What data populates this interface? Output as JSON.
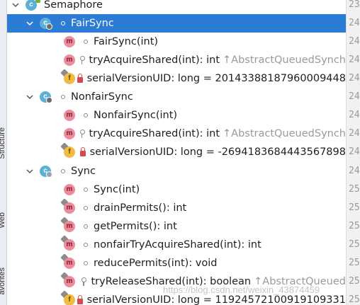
{
  "tool_window_tabs": [
    "Structure",
    "Web",
    "avorites"
  ],
  "tree": {
    "items": [
      {
        "label": "Semaphore",
        "kind": "class"
      },
      {
        "label": "FairSync",
        "kind": "class"
      },
      {
        "label": "FairSync(int)",
        "kind": "method"
      },
      {
        "label": "tryAcquireShared(int): int",
        "suffix": "AbstractQueuedSynch",
        "kind": "method"
      },
      {
        "label": "serialVersionUID: long = 20143388187960009448",
        "kind": "field"
      },
      {
        "label": "NonfairSync",
        "kind": "class"
      },
      {
        "label": "NonfairSync(int)",
        "kind": "method"
      },
      {
        "label": "tryAcquireShared(int): int",
        "suffix": "AbstractQueuedSynch",
        "kind": "method"
      },
      {
        "label": "serialVersionUID: long = -2694183684443567898",
        "kind": "field"
      },
      {
        "label": "Sync",
        "kind": "class"
      },
      {
        "label": "Sync(int)",
        "kind": "method"
      },
      {
        "label": "drainPermits(): int",
        "kind": "method"
      },
      {
        "label": "getPermits(): int",
        "kind": "method"
      },
      {
        "label": "nonfairTryAcquireShared(int): int",
        "kind": "method"
      },
      {
        "label": "reducePermits(int): void",
        "kind": "method"
      },
      {
        "label": "tryReleaseShared(int): boolean",
        "suffix": "AbstractQueued",
        "kind": "method"
      },
      {
        "label": "serialVersionUID: long = 11924572100919109331",
        "kind": "field"
      }
    ],
    "icons": {
      "class": "class-icon",
      "method": "method-icon",
      "field": "field-icon",
      "class_letter": "c",
      "method_letter": "m",
      "field_letter": "f",
      "inherited_arrow": "↑"
    }
  },
  "gutter": {
    "line_numbers": [
      "23",
      "24",
      "24",
      "24",
      "24",
      "24",
      "24",
      "24",
      "24",
      "24",
      "25",
      "25",
      "25",
      "25",
      "25",
      "25",
      "25"
    ]
  },
  "watermark": "https://blog.csdn.net/weixin_43874459",
  "colors": {
    "selection": "#2c7bd4",
    "class_icon": "#5ab0d6",
    "method_icon": "#ed8b9d",
    "field_icon": "#f2bc42",
    "private_lock": "#d6494d"
  }
}
